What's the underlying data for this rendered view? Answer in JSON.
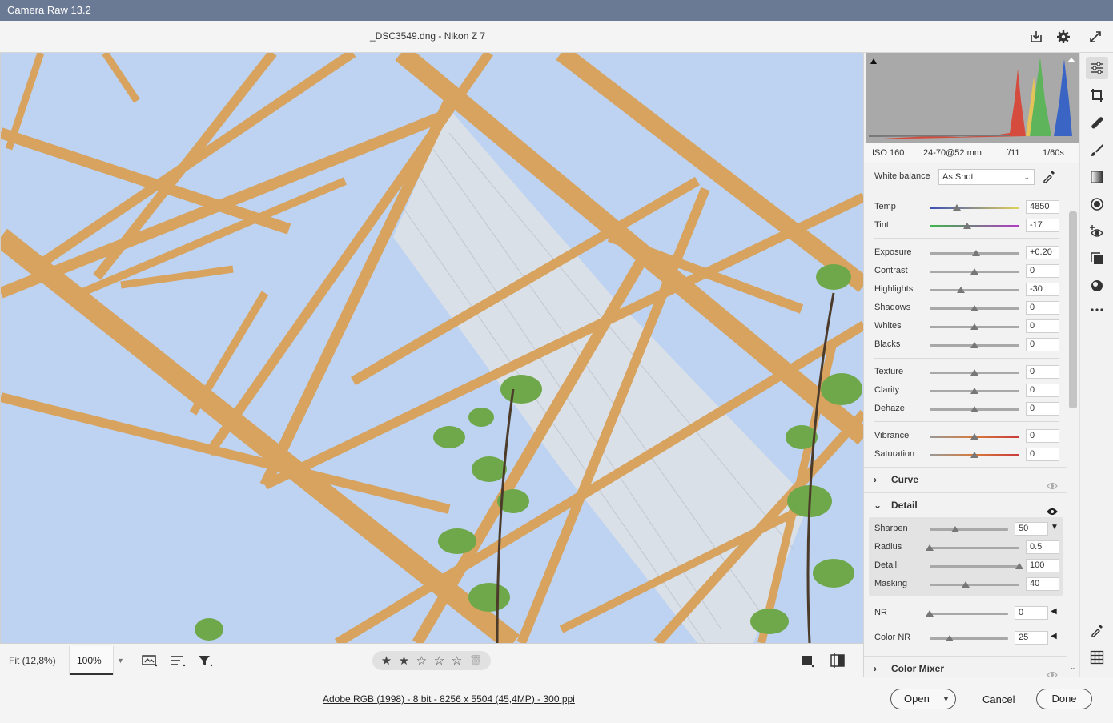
{
  "app": {
    "window_title": "Camera Raw 13.2",
    "document_title": "_DSC3549.dng  -  Nikon Z 7"
  },
  "header": {
    "icons": [
      "save-icon",
      "settings-icon",
      "fullscreen-icon"
    ]
  },
  "bottom_toolbar": {
    "zoom_fit": "Fit (12,8%)",
    "zoom_value": "100%",
    "rating_stars": 2,
    "rating_max": 5
  },
  "footer": {
    "file_info": "Adobe RGB (1998) - 8 bit - 8256 x 5504 (45,4MP) - 300 ppi",
    "open_label": "Open",
    "cancel_label": "Cancel",
    "done_label": "Done"
  },
  "exif": {
    "iso": "ISO 160",
    "lens": "24-70@52 mm",
    "aperture": "f/11",
    "shutter": "1/60s"
  },
  "basic": {
    "white_balance_label": "White balance",
    "white_balance_value": "As Shot",
    "sliders": [
      {
        "label": "Temp",
        "value": "4850",
        "position": 0.3
      },
      {
        "label": "Tint",
        "value": "-17",
        "position": 0.42
      },
      {
        "label": "Exposure",
        "value": "+0.20",
        "position": 0.52
      },
      {
        "label": "Contrast",
        "value": "0",
        "position": 0.5
      },
      {
        "label": "Highlights",
        "value": "-30",
        "position": 0.35
      },
      {
        "label": "Shadows",
        "value": "0",
        "position": 0.5
      },
      {
        "label": "Whites",
        "value": "0",
        "position": 0.5
      },
      {
        "label": "Blacks",
        "value": "0",
        "position": 0.5
      },
      {
        "label": "Texture",
        "value": "0",
        "position": 0.5
      },
      {
        "label": "Clarity",
        "value": "0",
        "position": 0.5
      },
      {
        "label": "Dehaze",
        "value": "0",
        "position": 0.5
      },
      {
        "label": "Vibrance",
        "value": "0",
        "position": 0.5
      },
      {
        "label": "Saturation",
        "value": "0",
        "position": 0.5
      }
    ]
  },
  "sections": {
    "curve": "Curve",
    "detail": "Detail",
    "color_mixer": "Color Mixer"
  },
  "detail": {
    "sliders": [
      {
        "label": "Sharpen",
        "value": "50",
        "position": 0.33
      },
      {
        "label": "Radius",
        "value": "0.5",
        "position": 0.0
      },
      {
        "label": "Detail",
        "value": "100",
        "position": 1.0
      },
      {
        "label": "Masking",
        "value": "40",
        "position": 0.4
      },
      {
        "label": "NR",
        "value": "0",
        "position": 0.0
      },
      {
        "label": "Color NR",
        "value": "25",
        "position": 0.25
      }
    ]
  },
  "tools": [
    "edit-icon",
    "crop-icon",
    "healing-icon",
    "brush-icon",
    "gradient-icon",
    "radial-filter-icon",
    "red-eye-icon",
    "snapshots-icon",
    "presets-icon",
    "more-icon",
    "eyedropper-icon",
    "grid-icon"
  ],
  "colors": {
    "title_bar": "#6b7a94",
    "sky": "#bdd3f1",
    "steel": "#d9a45e"
  }
}
